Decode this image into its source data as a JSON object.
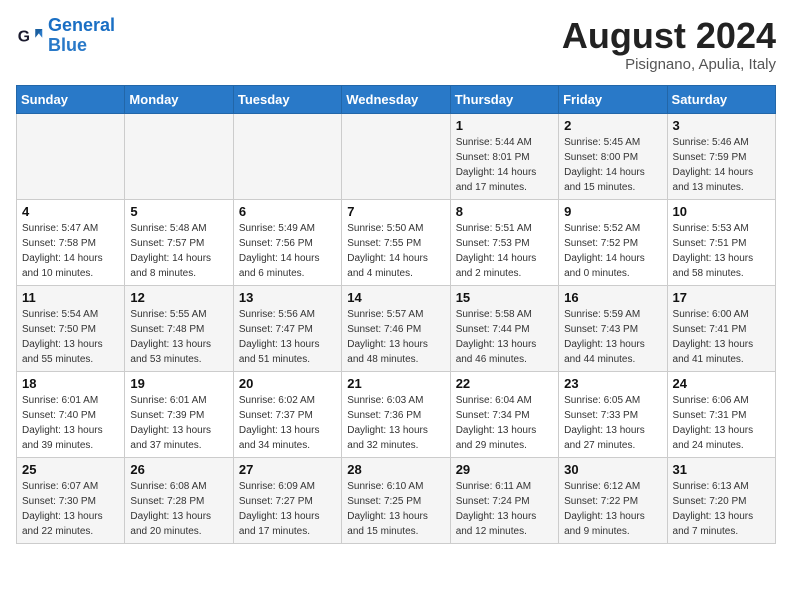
{
  "header": {
    "logo_line1": "General",
    "logo_line2": "Blue",
    "month_title": "August 2024",
    "subtitle": "Pisignano, Apulia, Italy"
  },
  "days_of_week": [
    "Sunday",
    "Monday",
    "Tuesday",
    "Wednesday",
    "Thursday",
    "Friday",
    "Saturday"
  ],
  "weeks": [
    [
      {
        "day": "",
        "info": ""
      },
      {
        "day": "",
        "info": ""
      },
      {
        "day": "",
        "info": ""
      },
      {
        "day": "",
        "info": ""
      },
      {
        "day": "1",
        "info": "Sunrise: 5:44 AM\nSunset: 8:01 PM\nDaylight: 14 hours\nand 17 minutes."
      },
      {
        "day": "2",
        "info": "Sunrise: 5:45 AM\nSunset: 8:00 PM\nDaylight: 14 hours\nand 15 minutes."
      },
      {
        "day": "3",
        "info": "Sunrise: 5:46 AM\nSunset: 7:59 PM\nDaylight: 14 hours\nand 13 minutes."
      }
    ],
    [
      {
        "day": "4",
        "info": "Sunrise: 5:47 AM\nSunset: 7:58 PM\nDaylight: 14 hours\nand 10 minutes."
      },
      {
        "day": "5",
        "info": "Sunrise: 5:48 AM\nSunset: 7:57 PM\nDaylight: 14 hours\nand 8 minutes."
      },
      {
        "day": "6",
        "info": "Sunrise: 5:49 AM\nSunset: 7:56 PM\nDaylight: 14 hours\nand 6 minutes."
      },
      {
        "day": "7",
        "info": "Sunrise: 5:50 AM\nSunset: 7:55 PM\nDaylight: 14 hours\nand 4 minutes."
      },
      {
        "day": "8",
        "info": "Sunrise: 5:51 AM\nSunset: 7:53 PM\nDaylight: 14 hours\nand 2 minutes."
      },
      {
        "day": "9",
        "info": "Sunrise: 5:52 AM\nSunset: 7:52 PM\nDaylight: 14 hours\nand 0 minutes."
      },
      {
        "day": "10",
        "info": "Sunrise: 5:53 AM\nSunset: 7:51 PM\nDaylight: 13 hours\nand 58 minutes."
      }
    ],
    [
      {
        "day": "11",
        "info": "Sunrise: 5:54 AM\nSunset: 7:50 PM\nDaylight: 13 hours\nand 55 minutes."
      },
      {
        "day": "12",
        "info": "Sunrise: 5:55 AM\nSunset: 7:48 PM\nDaylight: 13 hours\nand 53 minutes."
      },
      {
        "day": "13",
        "info": "Sunrise: 5:56 AM\nSunset: 7:47 PM\nDaylight: 13 hours\nand 51 minutes."
      },
      {
        "day": "14",
        "info": "Sunrise: 5:57 AM\nSunset: 7:46 PM\nDaylight: 13 hours\nand 48 minutes."
      },
      {
        "day": "15",
        "info": "Sunrise: 5:58 AM\nSunset: 7:44 PM\nDaylight: 13 hours\nand 46 minutes."
      },
      {
        "day": "16",
        "info": "Sunrise: 5:59 AM\nSunset: 7:43 PM\nDaylight: 13 hours\nand 44 minutes."
      },
      {
        "day": "17",
        "info": "Sunrise: 6:00 AM\nSunset: 7:41 PM\nDaylight: 13 hours\nand 41 minutes."
      }
    ],
    [
      {
        "day": "18",
        "info": "Sunrise: 6:01 AM\nSunset: 7:40 PM\nDaylight: 13 hours\nand 39 minutes."
      },
      {
        "day": "19",
        "info": "Sunrise: 6:01 AM\nSunset: 7:39 PM\nDaylight: 13 hours\nand 37 minutes."
      },
      {
        "day": "20",
        "info": "Sunrise: 6:02 AM\nSunset: 7:37 PM\nDaylight: 13 hours\nand 34 minutes."
      },
      {
        "day": "21",
        "info": "Sunrise: 6:03 AM\nSunset: 7:36 PM\nDaylight: 13 hours\nand 32 minutes."
      },
      {
        "day": "22",
        "info": "Sunrise: 6:04 AM\nSunset: 7:34 PM\nDaylight: 13 hours\nand 29 minutes."
      },
      {
        "day": "23",
        "info": "Sunrise: 6:05 AM\nSunset: 7:33 PM\nDaylight: 13 hours\nand 27 minutes."
      },
      {
        "day": "24",
        "info": "Sunrise: 6:06 AM\nSunset: 7:31 PM\nDaylight: 13 hours\nand 24 minutes."
      }
    ],
    [
      {
        "day": "25",
        "info": "Sunrise: 6:07 AM\nSunset: 7:30 PM\nDaylight: 13 hours\nand 22 minutes."
      },
      {
        "day": "26",
        "info": "Sunrise: 6:08 AM\nSunset: 7:28 PM\nDaylight: 13 hours\nand 20 minutes."
      },
      {
        "day": "27",
        "info": "Sunrise: 6:09 AM\nSunset: 7:27 PM\nDaylight: 13 hours\nand 17 minutes."
      },
      {
        "day": "28",
        "info": "Sunrise: 6:10 AM\nSunset: 7:25 PM\nDaylight: 13 hours\nand 15 minutes."
      },
      {
        "day": "29",
        "info": "Sunrise: 6:11 AM\nSunset: 7:24 PM\nDaylight: 13 hours\nand 12 minutes."
      },
      {
        "day": "30",
        "info": "Sunrise: 6:12 AM\nSunset: 7:22 PM\nDaylight: 13 hours\nand 9 minutes."
      },
      {
        "day": "31",
        "info": "Sunrise: 6:13 AM\nSunset: 7:20 PM\nDaylight: 13 hours\nand 7 minutes."
      }
    ]
  ]
}
